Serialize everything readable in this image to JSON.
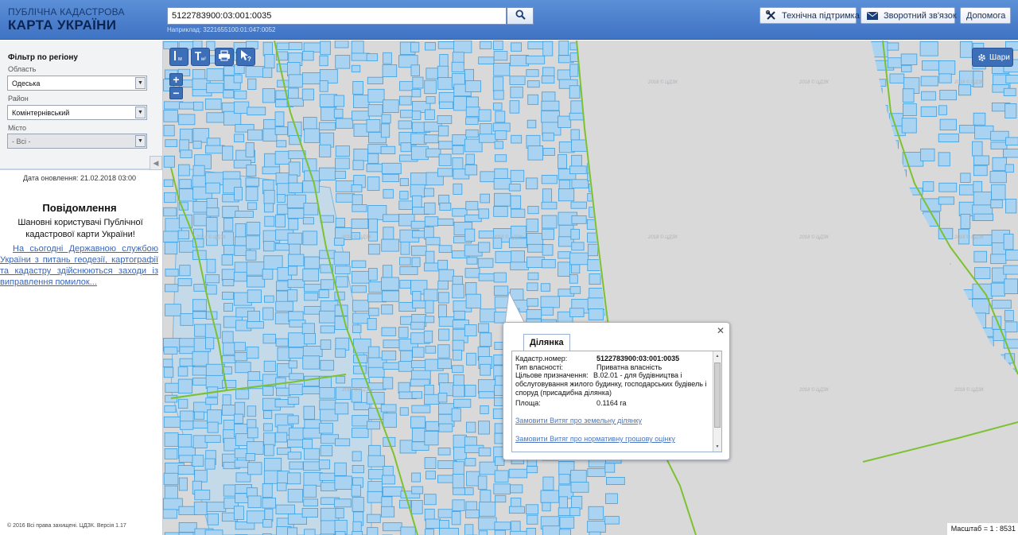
{
  "header": {
    "logo_line1": "ПУБЛІЧНА КАДАСТРОВА",
    "logo_line2": "КАРТА УКРАЇНИ",
    "search_value": "5122783900:03:001:0035",
    "search_hint": "Наприклад: 3221655100:01:047:0052",
    "support_label": "Технічна підтримка",
    "feedback_label": "Зворотний зв'язок",
    "help_label": "Допомога"
  },
  "sidebar": {
    "filter_title": "Фільтр по регіону",
    "oblast_label": "Область",
    "oblast_value": "Одеська",
    "rayon_label": "Район",
    "rayon_value": "Комінтернівський",
    "city_label": "Місто",
    "city_value": "- Всі -",
    "update_date": "Дата оновлення: 21.02.2018 03:00",
    "news_title": "Повідомлення",
    "news_text": "Шановні користувачі Публічної кадастрової карти України!",
    "news_link": "На сьогодні Державною службою України з питань геодезії, картографії та кадастру здійснюються заходи із виправлення помилок...",
    "copyright": "© 2016 Всі права захищені. ЦДЗК. Версія 1.17"
  },
  "map": {
    "layers_label": "Шари",
    "watermark": "2018 © ЦДЗК",
    "scale_text": "Масштаб = 1 : 8531",
    "tools": [
      "measure-length-icon",
      "measure-area-icon",
      "print-icon",
      "identify-icon"
    ]
  },
  "popup": {
    "tab_label": "Ділянка",
    "cadastral_label": "Кадастр.номер:",
    "cadastral_value": "5122783900:03:001:0035",
    "ownership_label": "Тип власності:",
    "ownership_value": "Приватна власність",
    "purpose_label": "Цільове призначення:",
    "purpose_value": "В.02.01 - для будівництва і обслуговування жилого будинку, господарських будівель і споруд (присадибна ділянка)",
    "area_label": "Площа:",
    "area_value": "0.1164 га",
    "link1": "Замовити Витяг про земельну ділянку",
    "link2": "Замовити Витяг про нормативну грошову оцінку"
  },
  "colors": {
    "header": "#4a7ecb",
    "parcel_fill": "#a9d3f0",
    "parcel_stroke": "#3aa0e4",
    "boundary": "#7cc230",
    "map_bg": "#d9d9d9"
  }
}
